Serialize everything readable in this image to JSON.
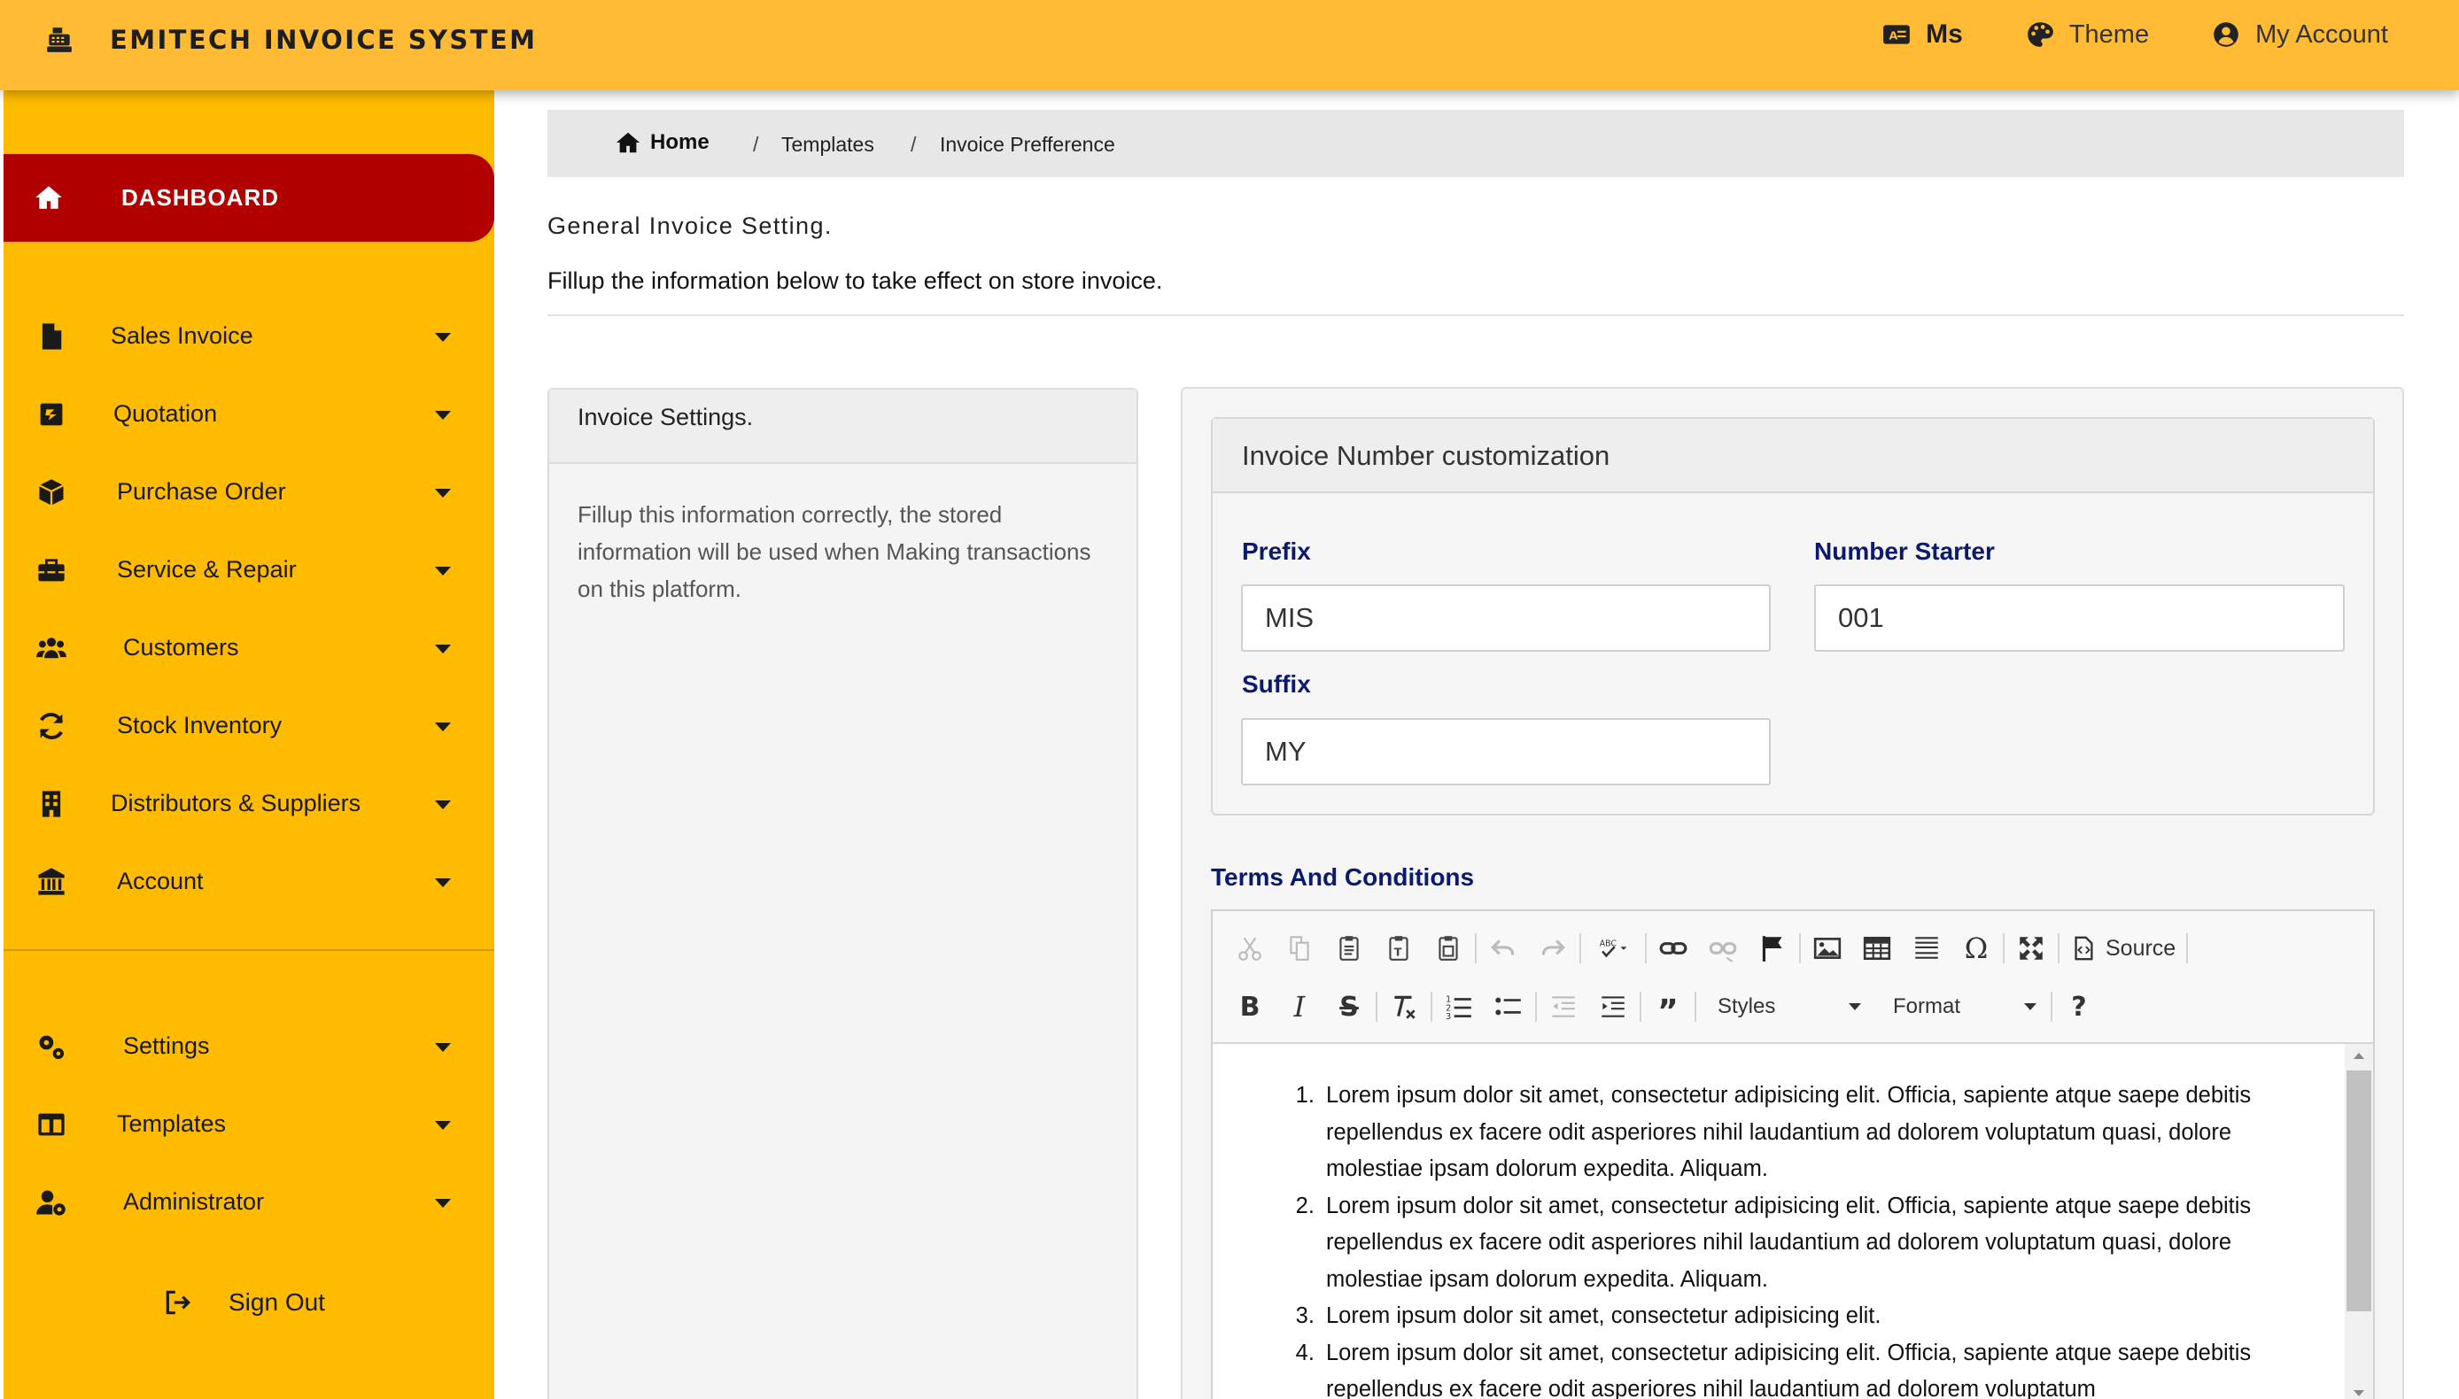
{
  "header": {
    "brand_icon": "cash-register-icon",
    "title": "EMITECH INVOICE SYSTEM",
    "language_label": "Ms",
    "theme_label": "Theme",
    "account_label": "My Account",
    "background_color": "#FFBB33"
  },
  "sidebar": {
    "background_color": "#FFBB00",
    "active_color": "#B00000",
    "dashboard_label": "DASHBOARD",
    "items": [
      {
        "label": "Sales Invoice",
        "icon": "file-icon"
      },
      {
        "label": "Quotation",
        "icon": "quote-icon"
      },
      {
        "label": "Purchase Order",
        "icon": "box-icon"
      },
      {
        "label": "Service & Repair",
        "icon": "toolbox-icon"
      },
      {
        "label": "Customers",
        "icon": "users-icon"
      },
      {
        "label": "Stock Inventory",
        "icon": "sync-icon"
      },
      {
        "label": "Distributors & Suppliers",
        "icon": "building-icon"
      },
      {
        "label": "Account",
        "icon": "bank-icon"
      },
      {
        "label": "Settings",
        "icon": "gears-icon"
      },
      {
        "label": "Templates",
        "icon": "columns-icon"
      },
      {
        "label": "Administrator",
        "icon": "user-cog-icon"
      }
    ],
    "signout_label": "Sign Out"
  },
  "breadcrumb": {
    "home": "Home",
    "separator": "/",
    "items": [
      "Templates",
      "Invoice Prefference"
    ]
  },
  "page": {
    "title": "General Invoice Setting.",
    "subtitle": "Fillup the information below to take effect on store invoice."
  },
  "invoice_settings": {
    "title": "Invoice Settings.",
    "description": "Fillup this information correctly, the stored information will be used when Making transactions on this platform."
  },
  "number_customization": {
    "title": "Invoice Number customization",
    "prefix_label": "Prefix",
    "prefix_value": "MIS",
    "starter_label": "Number Starter",
    "starter_value": "001",
    "suffix_label": "Suffix",
    "suffix_value": "MY"
  },
  "terms": {
    "label": "Terms And Conditions",
    "toolbar": {
      "source_label": "Source",
      "styles_label": "Styles",
      "format_label": "Format",
      "help_label": "?"
    },
    "items": [
      "Lorem ipsum dolor sit amet, consectetur adipisicing elit. Officia, sapiente atque saepe debitis repellendus ex facere odit asperiores nihil laudantium ad dolorem voluptatum quasi, dolore molestiae ipsam dolorum expedita. Aliquam.",
      "Lorem ipsum dolor sit amet, consectetur adipisicing elit. Officia, sapiente atque saepe debitis repellendus ex facere odit asperiores nihil laudantium ad dolorem voluptatum quasi, dolore molestiae ipsam dolorum expedita. Aliquam.",
      "Lorem ipsum dolor sit amet, consectetur adipisicing elit.",
      "Lorem ipsum dolor sit amet, consectetur adipisicing elit. Officia, sapiente atque saepe debitis repellendus ex facere odit asperiores nihil laudantium ad dolorem voluptatum"
    ]
  }
}
